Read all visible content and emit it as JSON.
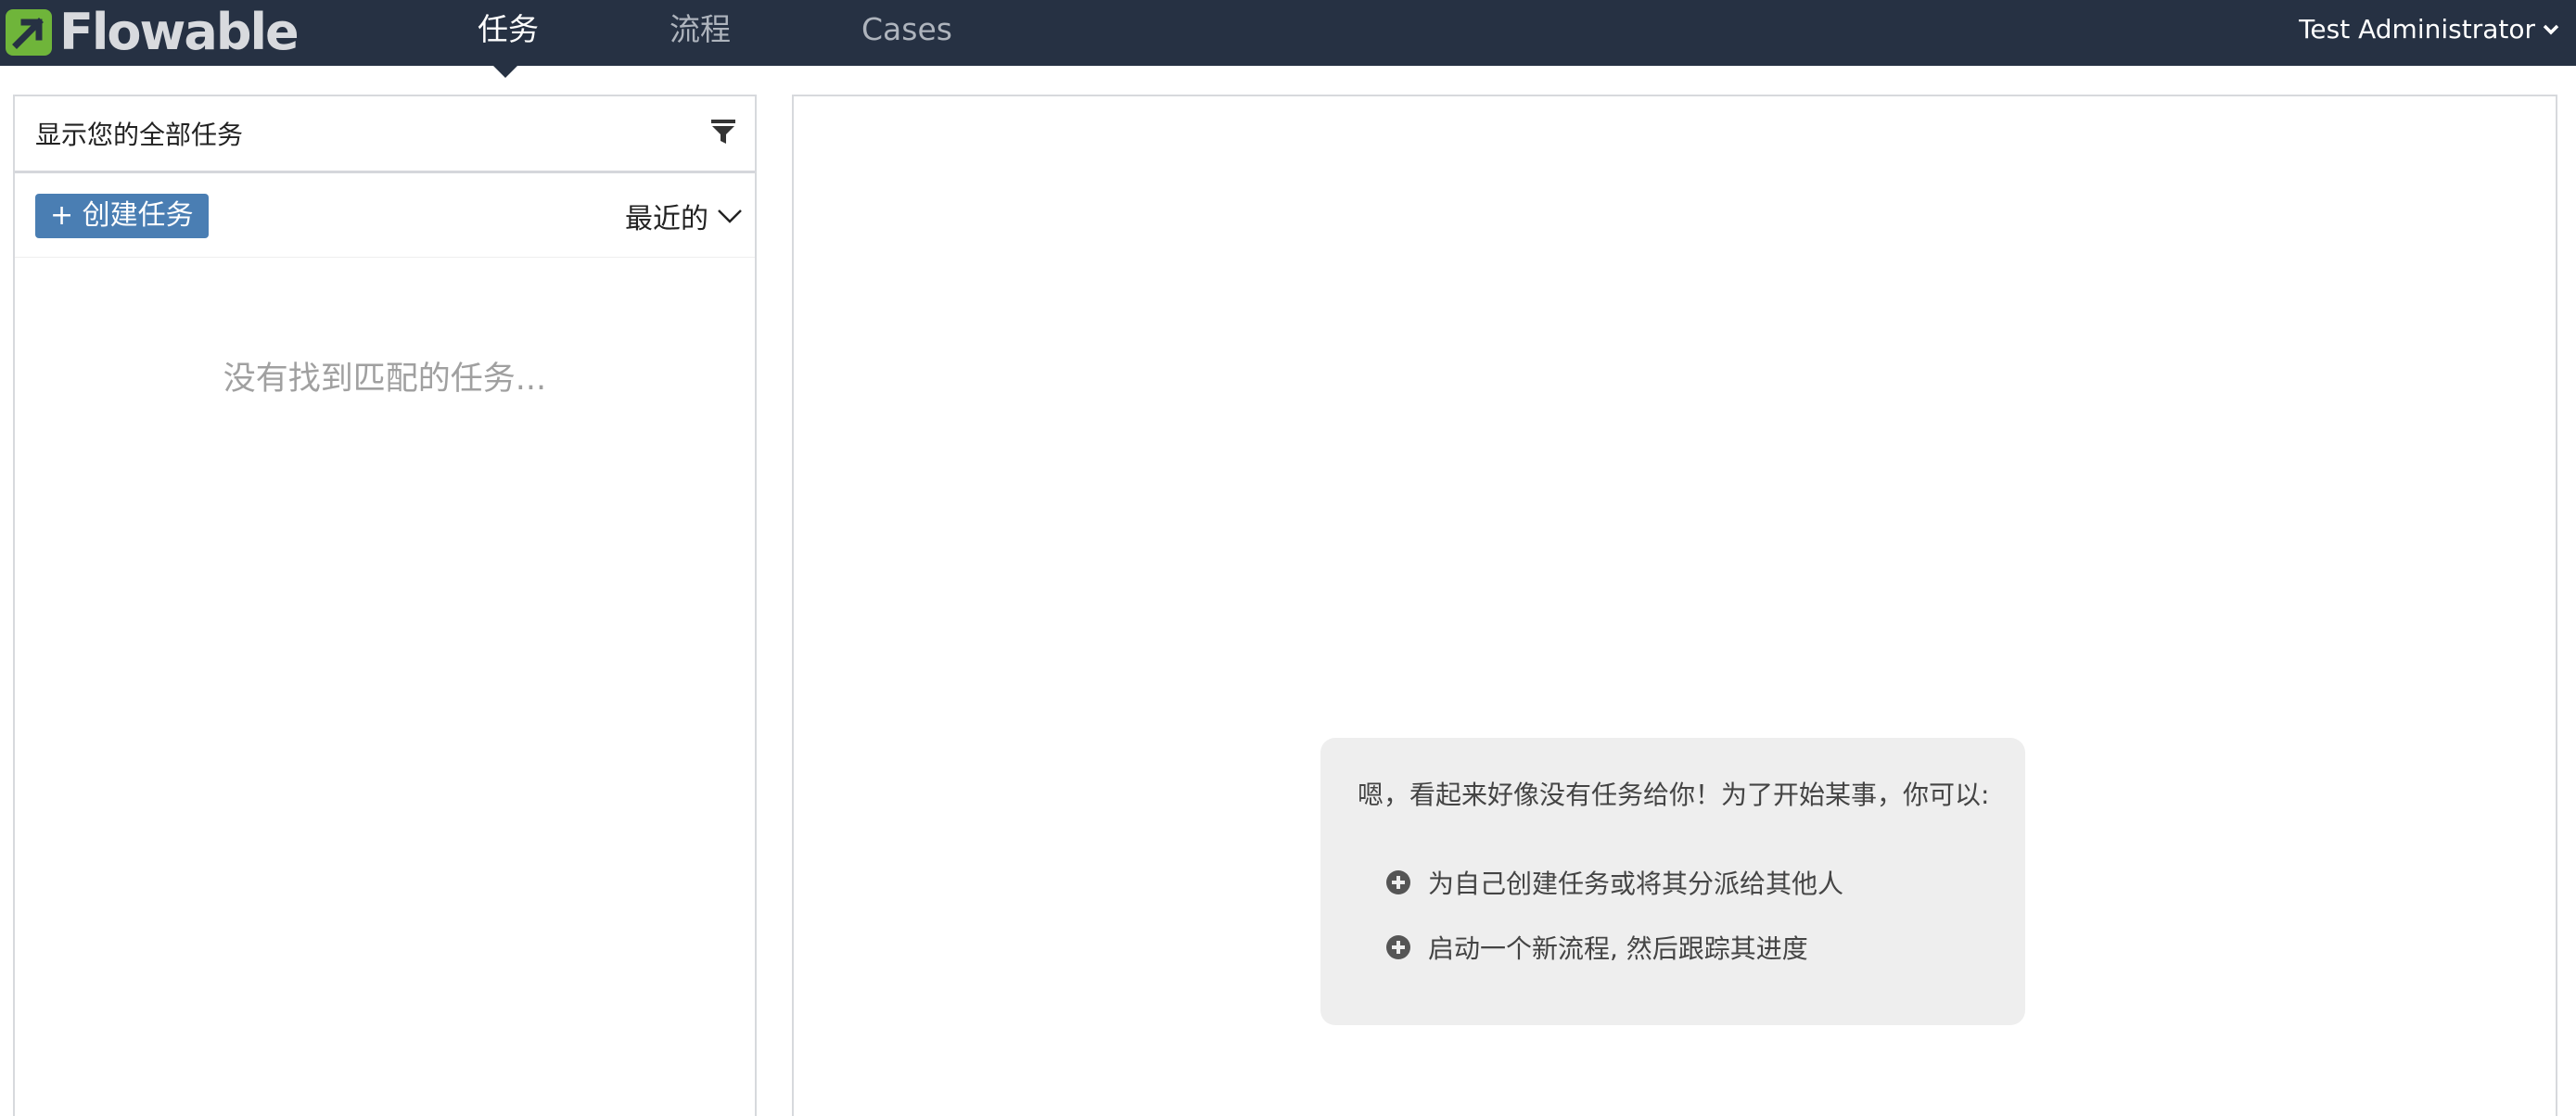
{
  "brand": {
    "name": "Flowable",
    "accent": "#6fb53a",
    "navbar_bg": "#263143"
  },
  "nav": {
    "tabs": [
      {
        "label": "任务",
        "active": true
      },
      {
        "label": "流程",
        "active": false
      },
      {
        "label": "Cases",
        "active": false
      }
    ],
    "user": "Test Administrator"
  },
  "task_list": {
    "filter_label": "显示您的全部任务",
    "create_label": "+ 创建任务",
    "sort_label": "最近的",
    "empty_message": "没有找到匹配的任务..."
  },
  "help": {
    "intro": "嗯，看起来好像没有任务给你！为了开始某事，你可以:",
    "items": [
      "为自己创建任务或将其分派给其他人",
      "启动一个新流程, 然后跟踪其进度"
    ]
  }
}
